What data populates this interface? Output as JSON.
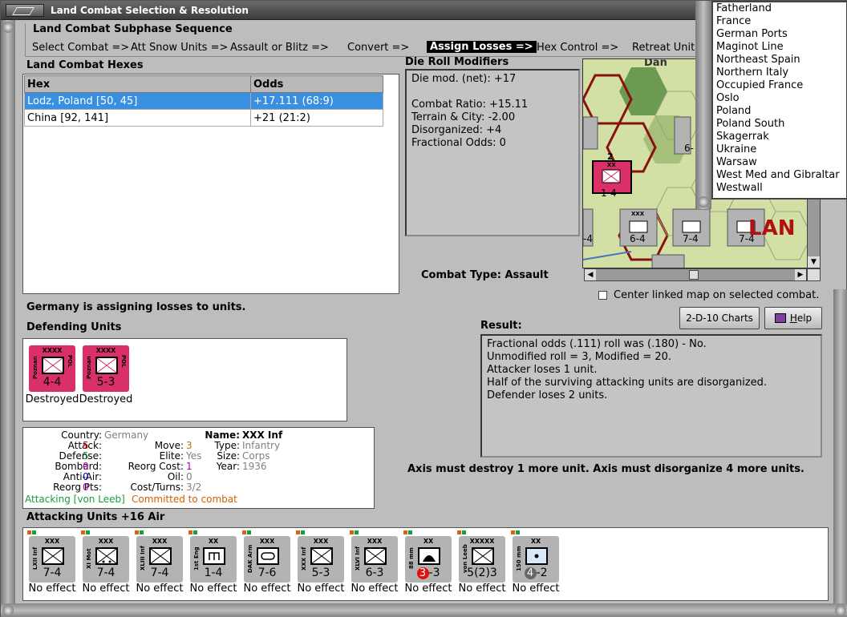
{
  "window": {
    "title": "Land Combat Selection & Resolution"
  },
  "colors": {
    "selected_row": "#3a90e0",
    "poland_counter": "#d9306a",
    "german_counter": "#b3b3b3",
    "green_text": "#1a9a40",
    "orange_text": "#d06000",
    "red_text": "#cc0000",
    "magenta_text": "#b000b0",
    "blue_text": "#0000cc",
    "grey_text": "#808080",
    "olive_text": "#a08000"
  },
  "subphase": {
    "title": "Land Combat Subphase Sequence",
    "steps": [
      "Select Combat =>",
      "Att Snow Units =>",
      "Assault or Blitz =>",
      "Convert =>",
      "Assign Losses =>",
      "Hex Control =>",
      "Retreat Units"
    ],
    "active_index": 4
  },
  "hexes": {
    "title": "Land Combat Hexes",
    "columns": [
      "Hex",
      "Odds"
    ],
    "rows": [
      {
        "hex": "Lodz, Poland [50, 45]",
        "odds": "+17.111 (68:9)",
        "selected": true
      },
      {
        "hex": "China [92, 141]",
        "odds": "+21 (21:2)",
        "selected": false
      }
    ]
  },
  "die_roll": {
    "title": "Die Roll Modifiers",
    "net": "Die mod. (net): +17",
    "lines": [
      "Combat Ratio: +15.11",
      "Terrain & City: -2.00",
      "Disorganized: +4",
      "Fractional Odds: 0"
    ]
  },
  "combat_type": "Combat Type:  Assault",
  "center_map": "Center linked map on selected combat.",
  "buttons": {
    "charts": "2-D-10 Charts",
    "help_prefix": "",
    "help_u": "H",
    "help_rest": "elp"
  },
  "assign_msg": "Germany is assigning losses to units.",
  "defending": {
    "title": "Defending Units",
    "units": [
      {
        "size": "XXXX",
        "side": "Poznan",
        "nation": "POL",
        "strength": "4-4",
        "status": "Destroyed"
      },
      {
        "size": "XXXX",
        "side": "Poznan",
        "nation": "POL",
        "strength": "5-3",
        "status": "Destroyed"
      }
    ]
  },
  "result": {
    "title": "Result:",
    "lines": [
      "Fractional odds (.111) roll was (.180)  - No.",
      "Unmodified roll = 3, Modified = 20.",
      "Attacker loses 1 unit.",
      "Half of the surviving attacking units are disorganized.",
      "Defender loses 2 units."
    ]
  },
  "axis_msg": "Axis must destroy 1 more unit. Axis must disorganize 4 more units.",
  "unit_info": {
    "country_lbl": "Country:",
    "country": "Germany",
    "attack_lbl": "Attack:",
    "attack": "5",
    "defense_lbl": "Defense:",
    "defense": "5",
    "bombard_lbl": "Bombard:",
    "bombard": "0",
    "antiair_lbl": "Anti-Air:",
    "antiair": "0",
    "reorg_lbl": "Reorg Pts:",
    "reorg": "0",
    "move_lbl": "Move:",
    "move": "3",
    "elite_lbl": "Elite:",
    "elite": "Yes",
    "reorgcost_lbl": "Reorg Cost:",
    "reorgcost": "1",
    "oil_lbl": "Oil:",
    "oil": "0",
    "costturns_lbl": "Cost/Turns:",
    "costturns": "3/2",
    "name_lbl": "Name:",
    "name": "XXX Inf",
    "type_lbl": "Type:",
    "type": "Infantry",
    "usize_lbl": "Size:",
    "usize": "Corps",
    "year_lbl": "Year:",
    "year": "1936",
    "attacking_status": "Attacking [von Leeb]",
    "committed_status": "Committed to combat"
  },
  "attacking": {
    "title": "Attacking Units +16 Air",
    "units": [
      {
        "size": "XXX",
        "side": "LXII Inf",
        "strength": "7-4",
        "status": "No effect",
        "sym": "inf"
      },
      {
        "size": "XXX",
        "side": "XI Mot",
        "strength": "7-4",
        "status": "No effect",
        "sym": "mot"
      },
      {
        "size": "XXX",
        "side": "XLIII Inf",
        "strength": "7-4",
        "status": "No effect",
        "sym": "inf"
      },
      {
        "size": "XX",
        "side": "1st Eng",
        "strength": "1-4",
        "status": "No effect",
        "sym": "eng"
      },
      {
        "size": "XXX",
        "side": "DAK Arm",
        "strength": "7-6",
        "status": "No effect",
        "sym": "arm"
      },
      {
        "size": "XXX",
        "side": "XXX Inf",
        "strength": "5-3",
        "status": "No effect",
        "sym": "inf"
      },
      {
        "size": "XXX",
        "side": "XLVI Inf",
        "strength": "6-3",
        "status": "No effect",
        "sym": "inf"
      },
      {
        "size": "XX",
        "side": "88 mm",
        "strength_a": "3",
        "strength_b": "-3",
        "status": "No effect",
        "sym": "aa"
      },
      {
        "size": "XXXXX",
        "side": "von Leeb",
        "strength": "5(2)3",
        "status": "No effect",
        "sym": "hq"
      },
      {
        "size": "XX",
        "side": "150 mm",
        "strength_a": "4",
        "strength_b": "-2",
        "status": "No effect",
        "sym": "art"
      }
    ]
  },
  "map_labels": {
    "top": "Dan",
    "poland": "LAN",
    "c1": "1-4",
    "c2": "6-4",
    "c3": "7-4",
    "c4": "7-4",
    "c5": "-4",
    "c6": "6-",
    "num": "2",
    "xx": "XX",
    "xxx": "XXX"
  },
  "dropdown": {
    "items": [
      "Fatherland",
      "France",
      "German Ports",
      "Maginot Line",
      "Northeast Spain",
      "Northern Italy",
      "Occupied France",
      "Oslo",
      "Poland",
      "Poland South",
      "Skagerrak",
      "Ukraine",
      "Warsaw",
      "West Med and Gibraltar",
      "Westwall"
    ]
  }
}
